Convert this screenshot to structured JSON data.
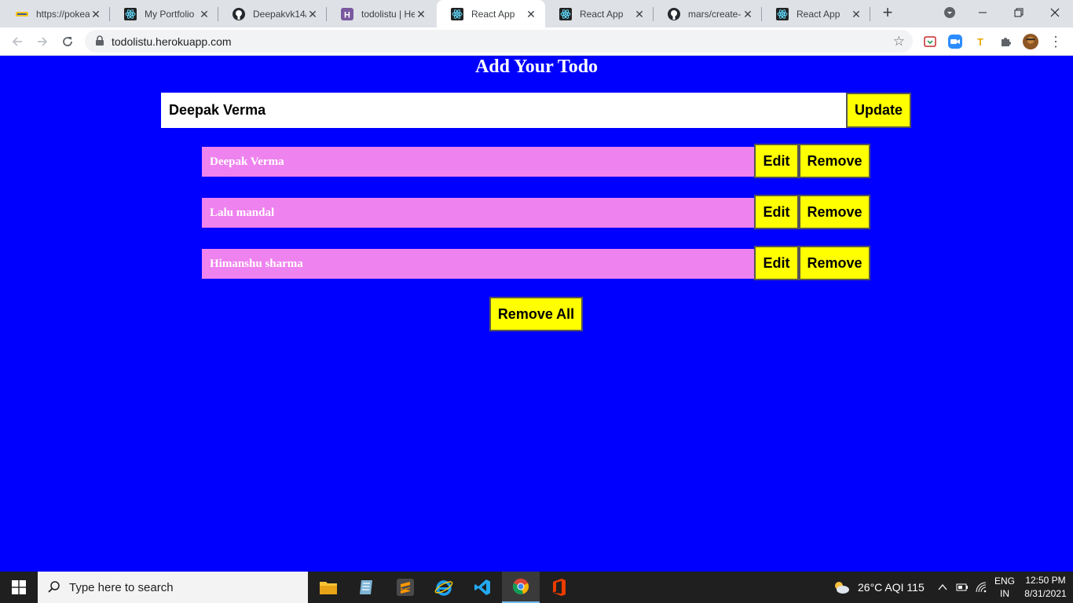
{
  "browser": {
    "tabs": [
      {
        "title": "https://pokea",
        "icon": "pokeapi-icon",
        "active": false
      },
      {
        "title": "My Portfolio",
        "icon": "react-icon",
        "active": false
      },
      {
        "title": "Deepakvk14/",
        "icon": "github-icon",
        "active": false
      },
      {
        "title": "todolistu | He",
        "icon": "heroku-icon",
        "active": false
      },
      {
        "title": "React App",
        "icon": "react-icon",
        "active": true
      },
      {
        "title": "React App",
        "icon": "react-icon",
        "active": false
      },
      {
        "title": "mars/create-r",
        "icon": "github-icon",
        "active": false
      },
      {
        "title": "React App",
        "icon": "react-icon",
        "active": false
      }
    ],
    "url": "todolistu.herokuapp.com"
  },
  "app": {
    "title": "Add Your Todo",
    "input_value": "Deepak Verma",
    "update_label": "Update",
    "edit_label": "Edit",
    "remove_label": "Remove",
    "remove_all_label": "Remove All",
    "todos": [
      {
        "text": "Deepak Verma"
      },
      {
        "text": "Lalu mandal"
      },
      {
        "text": "Himanshu sharma"
      }
    ]
  },
  "taskbar": {
    "search_placeholder": "Type here to search",
    "weather": "26°C  AQI 115",
    "lang_line1": "ENG",
    "lang_line2": "IN",
    "time": "12:50 PM",
    "date": "8/31/2021"
  },
  "colors": {
    "page_bg": "#0000ff",
    "todo_bg": "#ee82ee",
    "button_bg": "#ffff00"
  }
}
